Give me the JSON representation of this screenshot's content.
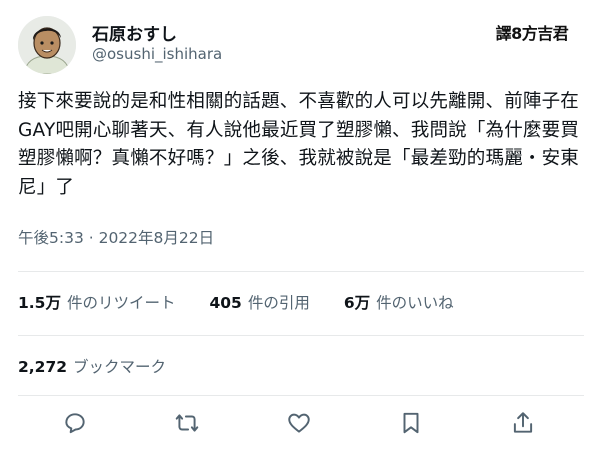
{
  "author": {
    "display_name": "石原おすし",
    "handle": "@osushi_ishihara"
  },
  "watermark": "譯8方吉君",
  "tweet": {
    "text": "接下來要說的是和性相關的話題、不喜歡的人可以先離開、前陣子在GAY吧開心聊著天、有人說他最近買了塑膠懶、我問說「為什麼要買塑膠懶啊？真懶不好嗎？」之後、我就被說是「最差勁的瑪麗・安東尼」了",
    "timestamp": "午後5:33 · 2022年8月22日"
  },
  "stats": {
    "retweets": {
      "count": "1.5万",
      "label": "件のリツイート"
    },
    "quotes": {
      "count": "405",
      "label": "件の引用"
    },
    "likes": {
      "count": "6万",
      "label": "件のいいね"
    },
    "bookmarks": {
      "count": "2,272",
      "label": "ブックマーク"
    }
  },
  "actions": [
    "reply-icon",
    "retweet-icon",
    "like-icon",
    "bookmark-icon",
    "share-icon"
  ]
}
